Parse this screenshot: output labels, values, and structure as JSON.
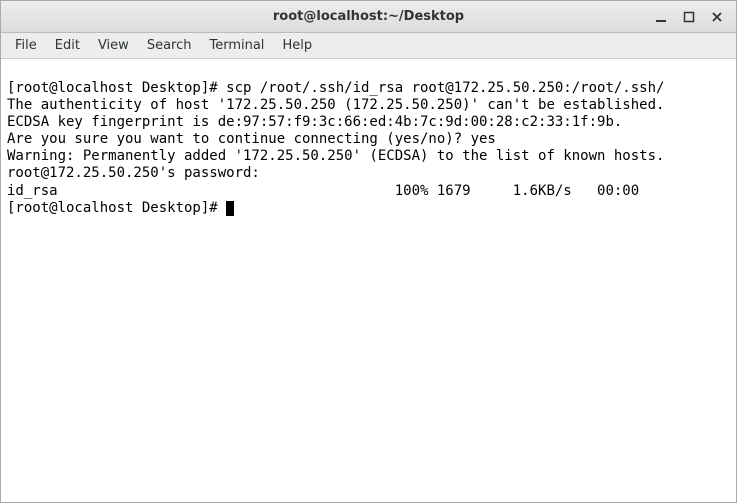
{
  "window": {
    "title": "root@localhost:~/Desktop"
  },
  "menu": {
    "file": "File",
    "edit": "Edit",
    "view": "View",
    "search": "Search",
    "terminal": "Terminal",
    "help": "Help"
  },
  "terminal": {
    "line1": "[root@localhost Desktop]# scp /root/.ssh/id_rsa root@172.25.50.250:/root/.ssh/",
    "line2": "The authenticity of host '172.25.50.250 (172.25.50.250)' can't be established.",
    "line3": "ECDSA key fingerprint is de:97:57:f9:3c:66:ed:4b:7c:9d:00:28:c2:33:1f:9b.",
    "line4": "Are you sure you want to continue connecting (yes/no)? yes",
    "line5": "Warning: Permanently added '172.25.50.250' (ECDSA) to the list of known hosts.",
    "line6": "root@172.25.50.250's password: ",
    "line7": "id_rsa                                        100% 1679     1.6KB/s   00:00    ",
    "line8": "[root@localhost Desktop]# "
  }
}
